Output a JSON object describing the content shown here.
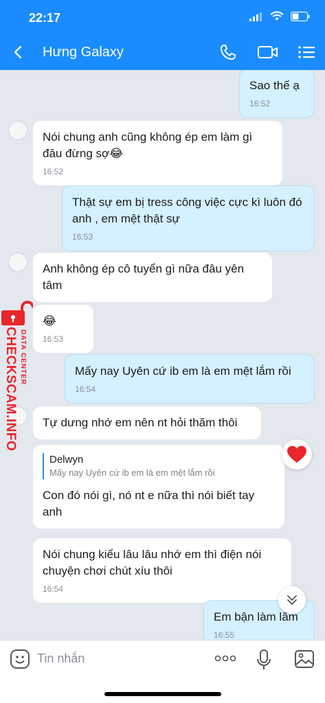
{
  "status": {
    "time": "22:17"
  },
  "header": {
    "title": "Hưng Galaxy"
  },
  "messages": [
    {
      "direction": "out",
      "text": "Sao thế ạ",
      "time": "16:52"
    },
    {
      "direction": "in",
      "text": "Nói chung anh cũng không ép em làm gì đâu đừng sợ😂",
      "time": "16:52"
    },
    {
      "direction": "out",
      "text": "Thật sự em bị tress công việc cực kì luôn đó anh , em mệt thật sự",
      "time": "16:53"
    },
    {
      "direction": "in",
      "text": "Anh không ép cô tuyển gì nữa đâu yên tâm",
      "time": ""
    },
    {
      "direction": "in",
      "text": "😂",
      "time": "16:53"
    },
    {
      "direction": "out",
      "text": "Mấy nay Uyên cứ ib em là em mệt lắm rồi",
      "time": "16:54"
    },
    {
      "direction": "in",
      "text": "Tự dưng nhớ em nên nt hỏi thăm thôi",
      "time": ""
    },
    {
      "direction": "in",
      "quote_name": "Delwyn",
      "quote_text": "Mấy nay Uyên cứ ib em là em mệt lắm rồi",
      "text": "Con đó nói gì, nó nt e nữa thì nói biết tay anh",
      "time": ""
    },
    {
      "direction": "in",
      "text": "Nói chung kiểu lâu lâu nhớ em thì điện nói chuyện chơi chút xíu thôi",
      "time": "16:54"
    },
    {
      "direction": "out",
      "text": "Em bận làm lắm",
      "time": "16:55"
    }
  ],
  "watermark": {
    "brand": "CHECKSCAM.INFO",
    "sub": "DATA CENTER"
  },
  "input": {
    "placeholder": "Tin nhắn",
    "more_label": "ooo"
  },
  "colors": {
    "header": "#1a8cff",
    "outgoing_bubble": "#d5f0ff",
    "incoming_bubble": "#ffffff",
    "watermark": "#e8262b"
  },
  "icons": [
    "back-arrow",
    "phone",
    "video-camera",
    "list-menu",
    "heart-reaction",
    "chevron-down",
    "emoji",
    "more-dots",
    "microphone",
    "image"
  ]
}
